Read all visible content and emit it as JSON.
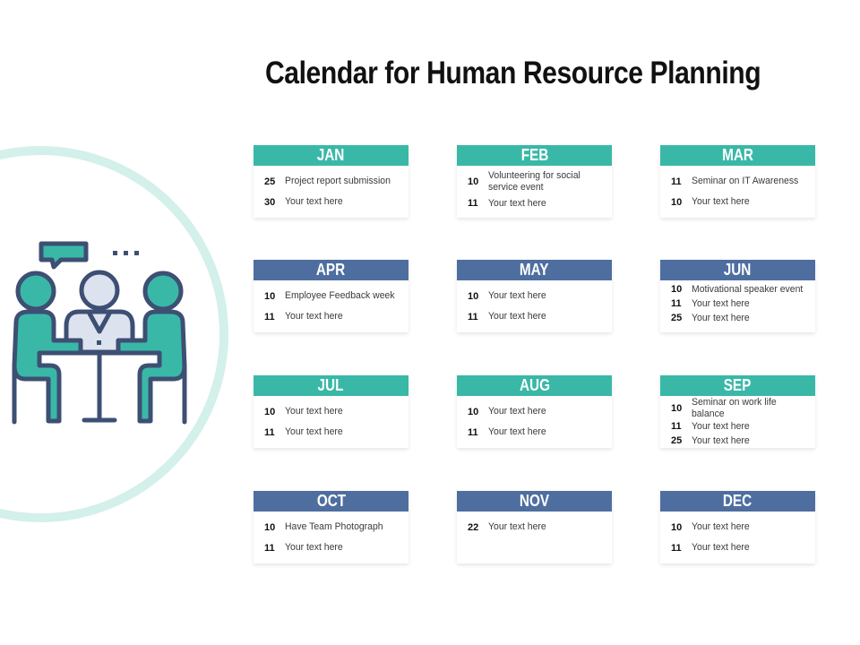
{
  "title": "Calendar for Human Resource Planning",
  "colors": {
    "teal": "#3ab8a7",
    "blue": "#4f6ea0",
    "ring": "#d3f0ea",
    "outline": "#3d4f73",
    "neutral": "#dde3ee"
  },
  "illustration": {
    "icon": "team-meeting-icon"
  },
  "months": [
    {
      "name": "JAN",
      "color": "teal",
      "events": [
        {
          "day": "25",
          "text": "Project report submission"
        },
        {
          "day": "30",
          "text": "Your text here"
        }
      ]
    },
    {
      "name": "FEB",
      "color": "teal",
      "events": [
        {
          "day": "10",
          "text": "Volunteering for social service event"
        },
        {
          "day": "11",
          "text": "Your text here"
        }
      ]
    },
    {
      "name": "MAR",
      "color": "teal",
      "events": [
        {
          "day": "11",
          "text": "Seminar on IT Awareness"
        },
        {
          "day": "10",
          "text": "Your text here"
        }
      ]
    },
    {
      "name": "APR",
      "color": "blue",
      "events": [
        {
          "day": "10",
          "text": "Employee Feedback week"
        },
        {
          "day": "11",
          "text": "Your text here"
        }
      ]
    },
    {
      "name": "MAY",
      "color": "blue",
      "events": [
        {
          "day": "10",
          "text": "Your text here"
        },
        {
          "day": "11",
          "text": "Your text here"
        }
      ]
    },
    {
      "name": "JUN",
      "color": "blue",
      "events": [
        {
          "day": "10",
          "text": "Motivational  speaker event"
        },
        {
          "day": "11",
          "text": "Your text here"
        },
        {
          "day": "25",
          "text": "Your text here"
        }
      ]
    },
    {
      "name": "JUL",
      "color": "teal",
      "events": [
        {
          "day": "10",
          "text": "Your text here"
        },
        {
          "day": "11",
          "text": "Your text here"
        }
      ]
    },
    {
      "name": "AUG",
      "color": "teal",
      "events": [
        {
          "day": "10",
          "text": "Your text here"
        },
        {
          "day": "11",
          "text": "Your text here"
        }
      ]
    },
    {
      "name": "SEP",
      "color": "teal",
      "events": [
        {
          "day": "10",
          "text": "Seminar on work life balance"
        },
        {
          "day": "11",
          "text": "Your text here"
        },
        {
          "day": "25",
          "text": "Your text here"
        }
      ]
    },
    {
      "name": "OCT",
      "color": "blue",
      "events": [
        {
          "day": "10",
          "text": "Have Team Photograph"
        },
        {
          "day": "11",
          "text": "Your text here"
        }
      ]
    },
    {
      "name": "NOV",
      "color": "blue",
      "events": [
        {
          "day": "22",
          "text": "Your text here"
        }
      ]
    },
    {
      "name": "DEC",
      "color": "blue",
      "events": [
        {
          "day": "10",
          "text": "Your text here"
        },
        {
          "day": "11",
          "text": "Your text here"
        }
      ]
    }
  ]
}
